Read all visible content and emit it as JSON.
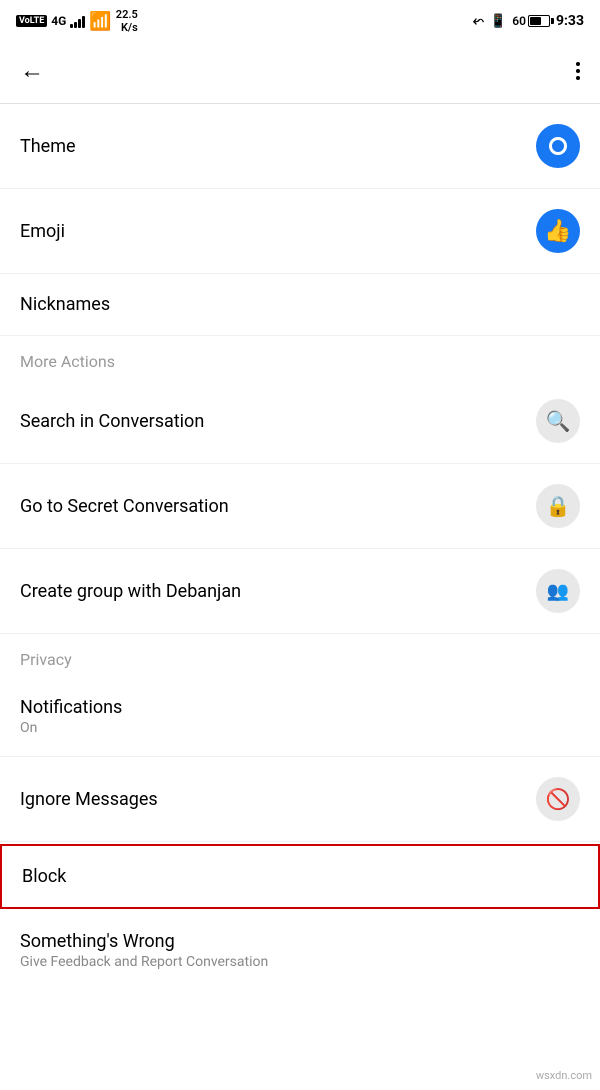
{
  "statusBar": {
    "left": {
      "volte": "VoLTE",
      "network": "4G",
      "dataSpeed": "22.5\nK/s"
    },
    "right": {
      "time": "9:33",
      "batteryPercent": "60"
    }
  },
  "topNav": {
    "backLabel": "←",
    "moreLabel": "⋮"
  },
  "sections": {
    "more_actions_header": "More Actions",
    "privacy_header": "Privacy"
  },
  "menuItems": [
    {
      "id": "theme",
      "label": "Theme",
      "sublabel": "",
      "icon": "theme-icon",
      "hasIcon": true
    },
    {
      "id": "emoji",
      "label": "Emoji",
      "sublabel": "",
      "icon": "emoji-icon",
      "hasIcon": true
    },
    {
      "id": "nicknames",
      "label": "Nicknames",
      "sublabel": "",
      "icon": "",
      "hasIcon": false
    },
    {
      "id": "search_in_conversation",
      "label": "Search in Conversation",
      "sublabel": "",
      "icon": "search-icon",
      "hasIcon": true
    },
    {
      "id": "go_to_secret",
      "label": "Go to Secret Conversation",
      "sublabel": "",
      "icon": "lock-icon",
      "hasIcon": true
    },
    {
      "id": "create_group",
      "label": "Create group with Debanjan",
      "sublabel": "",
      "icon": "group-icon",
      "hasIcon": true
    },
    {
      "id": "notifications",
      "label": "Notifications",
      "sublabel": "On",
      "icon": "",
      "hasIcon": false
    },
    {
      "id": "ignore_messages",
      "label": "Ignore Messages",
      "sublabel": "",
      "icon": "ignore-icon",
      "hasIcon": true
    },
    {
      "id": "block",
      "label": "Block",
      "sublabel": "",
      "icon": "",
      "hasIcon": false
    },
    {
      "id": "somethings_wrong",
      "label": "Something's Wrong",
      "sublabel": "Give Feedback and Report Conversation",
      "icon": "",
      "hasIcon": false
    }
  ],
  "watermark": "wsxdn.com"
}
